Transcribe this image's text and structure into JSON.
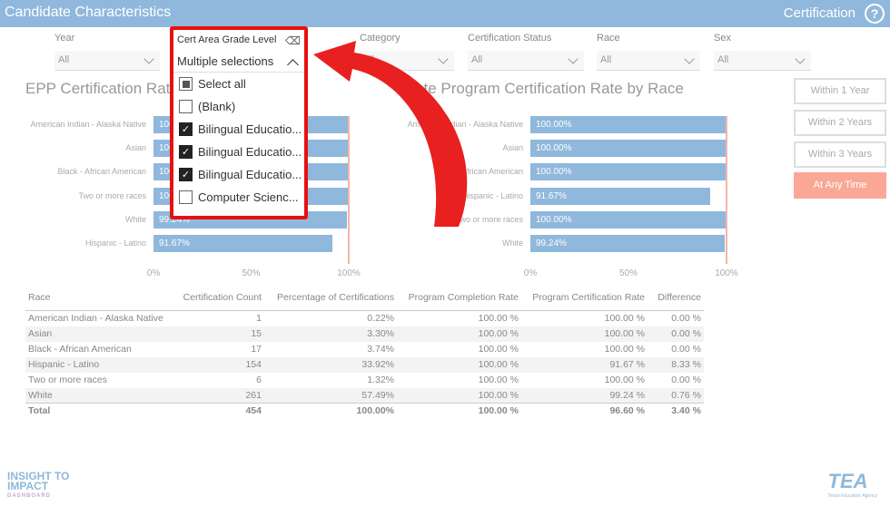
{
  "header": {
    "title": "Candidate Characteristics",
    "section": "Certification",
    "help": "?"
  },
  "filters": [
    {
      "label": "Year",
      "value": "All"
    },
    {
      "label": "Category",
      "value": "All"
    },
    {
      "label": "Certification Status",
      "value": "All"
    },
    {
      "label": "Race",
      "value": "All"
    },
    {
      "label": "Sex",
      "value": "All"
    }
  ],
  "dropdown": {
    "label": "Cert Area Grade Level",
    "value": "Multiple selections",
    "items": [
      {
        "label": "Select all",
        "state": "partial"
      },
      {
        "label": "(Blank)",
        "state": "off"
      },
      {
        "label": "Bilingual Educatio...",
        "state": "on"
      },
      {
        "label": "Bilingual Educatio...",
        "state": "on"
      },
      {
        "label": "Bilingual Educatio...",
        "state": "on"
      },
      {
        "label": "Computer Scienc...",
        "state": "off"
      }
    ]
  },
  "time_buttons": [
    "Within 1 Year",
    "Within 2 Years",
    "Within 3 Years",
    "At Any Time"
  ],
  "chart_data": [
    {
      "type": "bar",
      "title": "EPP Certification Rate by Race",
      "categories": [
        "American Indian - Alaska Native",
        "Asian",
        "Black - African American",
        "Two or more races",
        "White",
        "Hispanic - Latino"
      ],
      "values": [
        100,
        100,
        100,
        100,
        99.24,
        91.67
      ],
      "labels": [
        "100.00%",
        "100.00%",
        "100.00%",
        "100.00%",
        "99.24%",
        "91.67%"
      ],
      "xticks": [
        "0%",
        "50%",
        "100%"
      ],
      "xlim": [
        0,
        100
      ]
    },
    {
      "type": "bar",
      "title": "State Program Certification Rate by Race",
      "categories": [
        "American Indian - Alaska Native",
        "Asian",
        "Black - African American",
        "Hispanic - Latino",
        "Two or more races",
        "White"
      ],
      "values": [
        100,
        100,
        100,
        91.67,
        100,
        99.24
      ],
      "labels": [
        "100.00%",
        "100.00%",
        "100.00%",
        "91.67%",
        "100.00%",
        "99.24%"
      ],
      "xticks": [
        "0%",
        "50%",
        "100%"
      ],
      "xlim": [
        0,
        100
      ]
    }
  ],
  "table": {
    "headers": [
      "Race",
      "Certification Count",
      "Percentage of Certifications",
      "Program Completion Rate",
      "Program Certification Rate",
      "Difference"
    ],
    "rows": [
      [
        "American Indian - Alaska Native",
        "1",
        "0.22%",
        "100.00 %",
        "100.00 %",
        "0.00 %"
      ],
      [
        "Asian",
        "15",
        "3.30%",
        "100.00 %",
        "100.00 %",
        "0.00 %"
      ],
      [
        "Black - African American",
        "17",
        "3.74%",
        "100.00 %",
        "100.00 %",
        "0.00 %"
      ],
      [
        "Hispanic - Latino",
        "154",
        "33.92%",
        "100.00 %",
        "91.67 %",
        "8.33 %"
      ],
      [
        "Two or more races",
        "6",
        "1.32%",
        "100.00 %",
        "100.00 %",
        "0.00 %"
      ],
      [
        "White",
        "261",
        "57.49%",
        "100.00 %",
        "99.24 %",
        "0.76 %"
      ]
    ],
    "total": [
      "Total",
      "454",
      "100.00%",
      "100.00 %",
      "96.60 %",
      "3.40 %"
    ]
  },
  "logos": {
    "left": "INSIGHT TO IMPACT",
    "left_sub": "DASHBOARD",
    "right": "TEA",
    "right_sub": "Texas Education Agency"
  }
}
